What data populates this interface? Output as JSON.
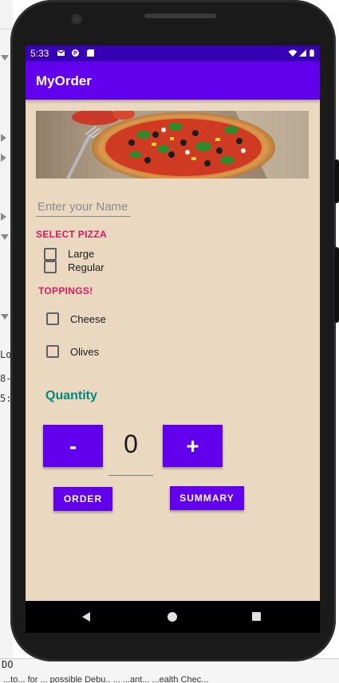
{
  "status_bar": {
    "time": "5:33"
  },
  "app": {
    "title": "MyOrder"
  },
  "name_field": {
    "placeholder": "Enter your Name"
  },
  "pizza_section": {
    "label": "SELECT PIZZA",
    "options": [
      {
        "label": "Large",
        "checked": false
      },
      {
        "label": "Regular",
        "checked": false
      }
    ]
  },
  "toppings_section": {
    "label": "TOPPINGS!",
    "options": [
      {
        "label": "Cheese",
        "checked": false
      },
      {
        "label": "Olives",
        "checked": false
      }
    ]
  },
  "quantity": {
    "label": "Quantity",
    "value": "0",
    "decrement_label": "-",
    "increment_label": "+"
  },
  "actions": {
    "order_label": "ORDER",
    "summary_label": "SUMMARY"
  },
  "ide": {
    "left_fragments": [
      "Lo",
      "8-",
      "5:3"
    ],
    "bottom_text": "DO",
    "status_text": "...to... for ... possible Debu.. ... ...ant... ...ealth Chec..."
  },
  "colors": {
    "primary": "#6200ee",
    "primary_dark": "#3700b3",
    "accent": "#d81b60",
    "quantity": "#00897b",
    "screen_background": "#ead9c0"
  }
}
